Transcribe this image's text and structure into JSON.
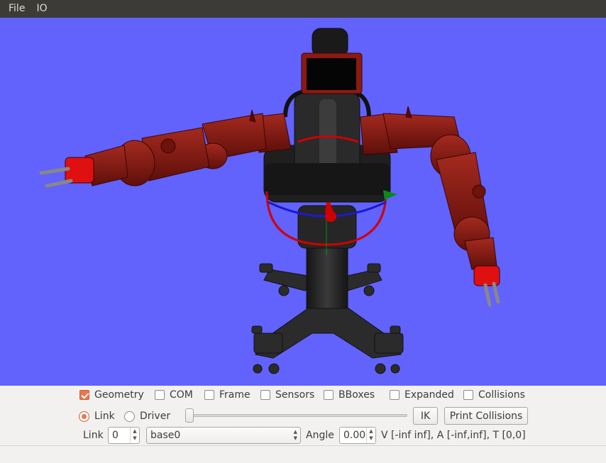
{
  "menu": {
    "file": "File",
    "io": "IO"
  },
  "viewport": {
    "background": "#6262fd",
    "robot_color": "#8c1a12",
    "scene": "robot model"
  },
  "options": {
    "geometry": {
      "label": "Geometry",
      "checked": true
    },
    "com": {
      "label": "COM",
      "checked": false
    },
    "frame": {
      "label": "Frame",
      "checked": false
    },
    "sensors": {
      "label": "Sensors",
      "checked": false
    },
    "bboxes": {
      "label": "BBoxes",
      "checked": false
    },
    "expanded": {
      "label": "Expanded",
      "checked": false
    },
    "collisions": {
      "label": "Collisions",
      "checked": false
    }
  },
  "mode": {
    "link": {
      "label": "Link",
      "selected": true
    },
    "driver": {
      "label": "Driver",
      "selected": false
    }
  },
  "buttons": {
    "ik": "IK",
    "print_collisions": "Print Collisions"
  },
  "link_row": {
    "link_label": "Link",
    "link_index": "0",
    "link_name": "base0",
    "angle_label": "Angle",
    "angle_value": "0.00",
    "info": "V [-inf inf], A [-inf,inf], T [0,0]"
  }
}
